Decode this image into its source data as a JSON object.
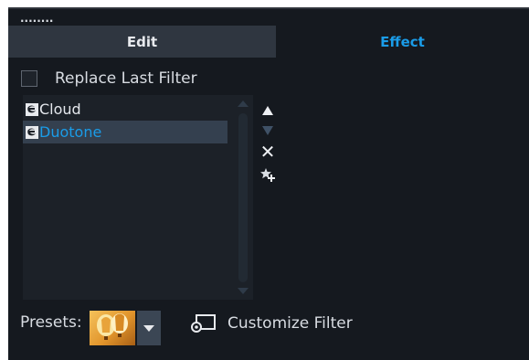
{
  "header": {
    "grip_dots": "........"
  },
  "tabs": [
    {
      "label": "Edit",
      "active": false
    },
    {
      "label": "Effect",
      "active": true
    }
  ],
  "replace_last_filter": {
    "label": "Replace Last Filter",
    "checked": false
  },
  "filters": [
    {
      "label": "Cloud",
      "icon": "filter-fx-icon",
      "selected": false
    },
    {
      "label": "Duotone",
      "icon": "filter-fx-icon",
      "selected": true
    }
  ],
  "tools": {
    "move_up": "move-up-icon",
    "move_down": "move-down-icon",
    "delete_glyph": "✕",
    "add_favorite": "add-favorite-icon"
  },
  "presets": {
    "label": "Presets:",
    "thumbnail": "hot-air-balloons"
  },
  "customize_filter": {
    "label": "Customize Filter",
    "icon": "customize-filter-icon"
  },
  "colors": {
    "panel_bg": "#15191f",
    "tab_inactive_bg": "#2f3640",
    "accent": "#1a9ce8",
    "selected_row": "#34404f",
    "list_bg": "#1c2128"
  }
}
